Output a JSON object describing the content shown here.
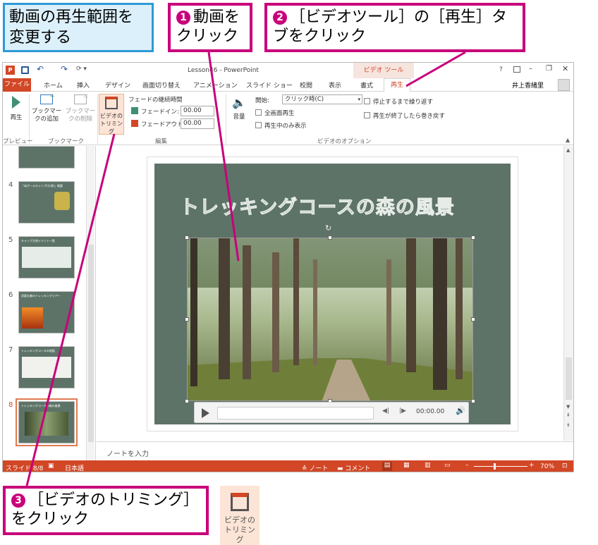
{
  "callouts": {
    "title": "動画の再生範囲を変更する",
    "step1": {
      "num": "1",
      "text": "動画をクリック"
    },
    "step2": {
      "num": "2",
      "text": "［ビデオツール］の［再生］タブをクリック"
    },
    "step3": {
      "num": "3",
      "text": "［ビデオのトリミング］をクリック"
    }
  },
  "window": {
    "title": "Lesson46 - PowerPoint",
    "context_tab_group": "ビデオ ツール",
    "help": "?",
    "user": "井上香緒里"
  },
  "tabs": [
    "ファイル",
    "ホーム",
    "挿入",
    "デザイン",
    "画面切り替え",
    "アニメーション",
    "スライド ショー",
    "校閲",
    "表示",
    "書式",
    "再生"
  ],
  "ribbon": {
    "play_label": "再生",
    "add_bookmark": "ブックマークの追加",
    "remove_bookmark": "ブックマークの削除",
    "trim_video": "ビデオのトリミング",
    "fade_duration": "フェードの継続時間",
    "fade_in": "フェードイン:",
    "fade_out": "フェードアウト:",
    "fade_in_value": "00.00",
    "fade_out_value": "00.00",
    "volume": "音量",
    "start_label": "開始:",
    "start_value": "クリック時(C)",
    "fullscreen": "全画面再生",
    "hide_not_playing": "再生中のみ表示",
    "loop": "停止するまで繰り返す",
    "rewind": "再生が終了したら巻き戻す",
    "groups": {
      "preview": "プレビュー",
      "bookmark": "ブックマーク",
      "edit": "編集",
      "options": "ビデオのオプション"
    }
  },
  "thumbnails": [
    {
      "num": "4",
      "title": "「ぬポールキャンプ(大地)」概要"
    },
    {
      "num": "5",
      "title": "キャンプ大地イベント一覧"
    },
    {
      "num": "6",
      "title": "初夏お森のトレッキングツアー"
    },
    {
      "num": "7",
      "title": "トレッキングコースの地図"
    },
    {
      "num": "8",
      "title": "トレッキングコースの森の風景"
    }
  ],
  "slide": {
    "title": "トレッキングコースの森の風景",
    "player_time": "00:00.00"
  },
  "notes_placeholder": "ノートを入力",
  "status": {
    "slide_info": "スライド 8/8",
    "language": "日本語",
    "notes": "ノート",
    "comments": "コメント",
    "zoom": "70%"
  },
  "bottom_icon_label": "ビデオのトリミング",
  "colors": {
    "accent": "#c8007a",
    "ribbon_red": "#d24726",
    "slide_bg": "#5e7367",
    "title_box": "#dcf0fb"
  }
}
